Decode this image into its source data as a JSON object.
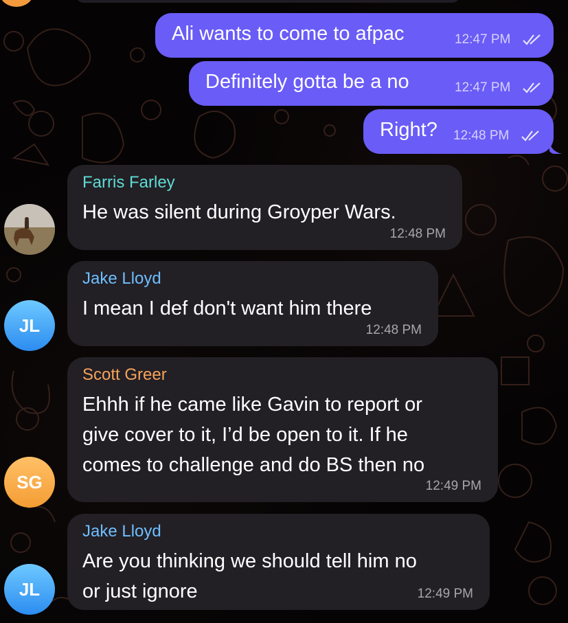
{
  "messages": [
    {
      "direction": "out",
      "text": "Ali wants to come to afpac",
      "time": "12:47 PM",
      "status_icon": "double-check-icon"
    },
    {
      "direction": "out",
      "text": "Definitely gotta be a no",
      "time": "12:47 PM",
      "status_icon": "double-check-icon"
    },
    {
      "direction": "out",
      "text": "Right?",
      "time": "12:48 PM",
      "status_icon": "double-check-icon"
    },
    {
      "direction": "in",
      "sender": "Farris Farley",
      "sender_color": "#5fdcd4",
      "lines": [
        "He was silent during Groyper Wars."
      ],
      "time": "12:48 PM",
      "avatar": "photo"
    },
    {
      "direction": "in",
      "sender": "Jake Lloyd",
      "sender_color": "#6fbfff",
      "lines": [
        "I mean I def don't want him there"
      ],
      "time": "12:48 PM",
      "avatar": "JL"
    },
    {
      "direction": "in",
      "sender": "Scott Greer",
      "sender_color": "#f5a35b",
      "lines": [
        "Ehhh if he came like Gavin to report or",
        "give cover to it, I’d be open to it. If he",
        "comes to challenge and do BS then no"
      ],
      "time": "12:49 PM",
      "avatar": "SG"
    },
    {
      "direction": "in",
      "sender": "Jake Lloyd",
      "sender_color": "#6fbfff",
      "lines": [
        "Are you thinking we should tell him no",
        "or just ignore"
      ],
      "time": "12:49 PM",
      "avatar": "JL"
    }
  ],
  "colors": {
    "outgoing_bubble": "#6a5cf6",
    "incoming_bubble": "#221f25",
    "background": "#050304"
  }
}
